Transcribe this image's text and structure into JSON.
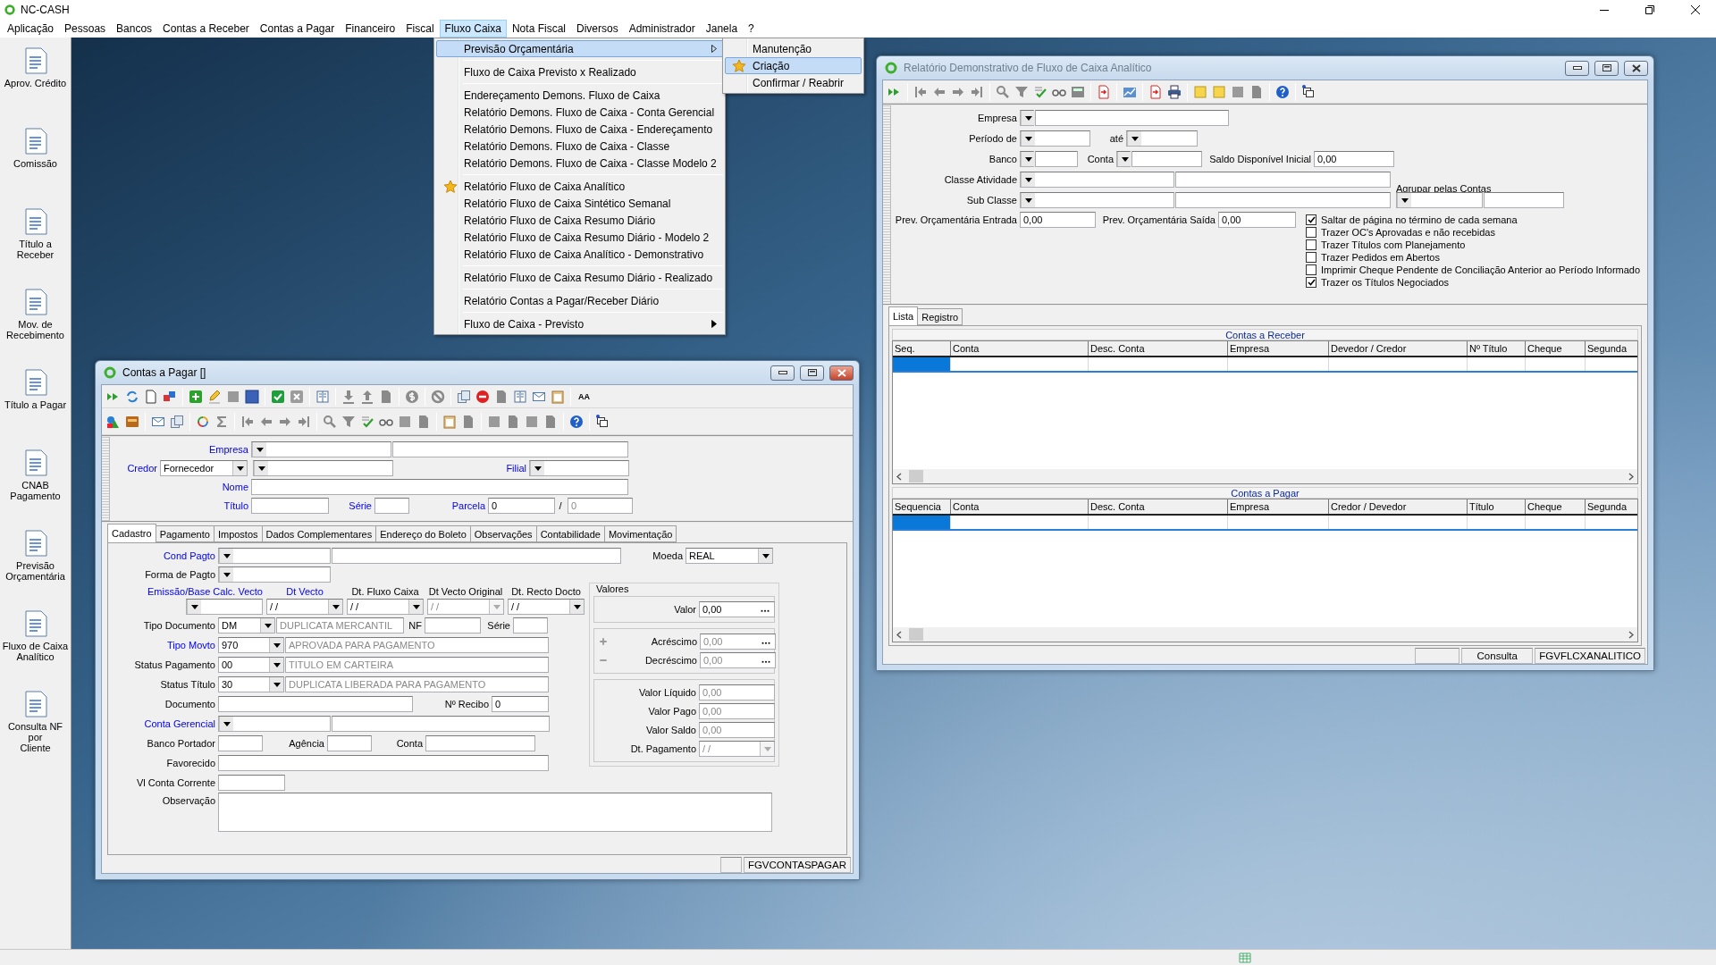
{
  "app": {
    "title": "NC-CASH"
  },
  "menubar": [
    {
      "label": "Aplicação",
      "selected": false
    },
    {
      "label": "Pessoas",
      "selected": false
    },
    {
      "label": "Bancos",
      "selected": false
    },
    {
      "label": "Contas a Receber",
      "selected": false
    },
    {
      "label": "Contas a Pagar",
      "selected": false
    },
    {
      "label": "Financeiro",
      "selected": false
    },
    {
      "label": "Fiscal",
      "selected": false
    },
    {
      "label": "Fluxo Caixa",
      "selected": true
    },
    {
      "label": "Nota Fiscal",
      "selected": false
    },
    {
      "label": "Diversos",
      "selected": false
    },
    {
      "label": "Administrador",
      "selected": false
    },
    {
      "label": "Janela",
      "selected": false
    },
    {
      "label": "?",
      "selected": false
    }
  ],
  "dropdown": {
    "items": [
      {
        "kind": "item",
        "label": "Previsão Orçamentária",
        "selected": true,
        "icon": false,
        "submenu": true
      },
      {
        "kind": "separator"
      },
      {
        "kind": "item",
        "label": "Fluxo de Caixa Previsto x Realizado",
        "selected": false,
        "icon": false,
        "submenu": false
      },
      {
        "kind": "separator"
      },
      {
        "kind": "item",
        "label": "Endereçamento Demons. Fluxo de Caixa",
        "selected": false,
        "icon": false,
        "submenu": false
      },
      {
        "kind": "item",
        "label": "Relatório Demons. Fluxo de Caixa - Conta Gerencial",
        "selected": false,
        "icon": false,
        "submenu": false
      },
      {
        "kind": "item",
        "label": "Relatório Demons. Fluxo de Caixa - Endereçamento",
        "selected": false,
        "icon": false,
        "submenu": false
      },
      {
        "kind": "item",
        "label": "Relatório Demons. Fluxo de Caixa - Classe",
        "selected": false,
        "icon": false,
        "submenu": false
      },
      {
        "kind": "item",
        "label": "Relatório Demons. Fluxo de Caixa - Classe Modelo 2",
        "selected": false,
        "icon": false,
        "submenu": false
      },
      {
        "kind": "separator"
      },
      {
        "kind": "item",
        "label": "Relatório Fluxo de Caixa Analítico",
        "selected": false,
        "icon": true,
        "submenu": false
      },
      {
        "kind": "item",
        "label": "Relatório Fluxo de Caixa Sintético Semanal",
        "selected": false,
        "icon": false,
        "submenu": false
      },
      {
        "kind": "item",
        "label": "Relatório Fluxo de Caixa Resumo Diário",
        "selected": false,
        "icon": false,
        "submenu": false
      },
      {
        "kind": "item",
        "label": "Relatório Fluxo de Caixa Resumo Diário - Modelo 2",
        "selected": false,
        "icon": false,
        "submenu": false
      },
      {
        "kind": "item",
        "label": "Relatório Fluxo de Caixa Analítico - Demonstrativo",
        "selected": false,
        "icon": false,
        "submenu": false
      },
      {
        "kind": "separator"
      },
      {
        "kind": "item",
        "label": "Relatório Fluxo de Caixa Resumo Diário - Realizado",
        "selected": false,
        "icon": false,
        "submenu": false
      },
      {
        "kind": "separator"
      },
      {
        "kind": "item",
        "label": "Relatório Contas a Pagar/Receber Diário",
        "selected": false,
        "icon": false,
        "submenu": false
      },
      {
        "kind": "separator"
      },
      {
        "kind": "item",
        "label": "Fluxo de Caixa - Previsto",
        "selected": false,
        "icon": false,
        "submenu": true
      }
    ]
  },
  "submenu": {
    "items": [
      {
        "label": "Manutenção",
        "selected": false,
        "icon": false
      },
      {
        "label": "Criação",
        "selected": true,
        "icon": true
      },
      {
        "label": "Confirmar / Reabrir",
        "selected": false,
        "icon": false
      }
    ]
  },
  "sidebar": {
    "items": [
      {
        "label": "Aprov. Crédito"
      },
      {
        "label": "Comissão"
      },
      {
        "label": "Título a\nReceber"
      },
      {
        "label": "Mov. de\nRecebimento"
      },
      {
        "label": "Título a Pagar"
      },
      {
        "label": "CNAB\nPagamento"
      },
      {
        "label": "Previsão\nOrçamentária"
      },
      {
        "label": "Fluxo de Caixa\nAnalítico"
      },
      {
        "label": "Consulta NF por\nCliente"
      }
    ]
  },
  "contas_pagar": {
    "title": "Contas a Pagar []",
    "active": true,
    "font_button": "AA",
    "header": {
      "empresa": "Empresa",
      "credor": "Credor",
      "credor_tipo": "Fornecedor",
      "filial": "Filial",
      "nome": "Nome",
      "titulo": "Título",
      "serie": "Série",
      "parcela": "Parcela",
      "parcela_value": "0",
      "parcela_sep": "/",
      "parcela_total": "0"
    },
    "tabs": [
      {
        "label": "Cadastro",
        "selected": true
      },
      {
        "label": "Pagamento",
        "selected": false
      },
      {
        "label": "Impostos",
        "selected": false
      },
      {
        "label": "Dados Complementares",
        "selected": false
      },
      {
        "label": "Endereço do Boleto",
        "selected": false
      },
      {
        "label": "Observações",
        "selected": false
      },
      {
        "label": "Contabilidade",
        "selected": false
      },
      {
        "label": "Movimentação",
        "selected": false
      }
    ],
    "cadastro": {
      "cond_pagto": "Cond Pagto",
      "moeda": "Moeda",
      "moeda_value": "REAL",
      "forma_pagto": "Forma de Pagto",
      "dates": [
        {
          "label": "Emissão/Base Calc. Vecto",
          "link": true,
          "disabled": false
        },
        {
          "label": "Dt Vecto",
          "value": "/ /",
          "link": true,
          "disabled": false
        },
        {
          "label": "Dt. Fluxo Caixa",
          "value": "/ /",
          "link": false,
          "disabled": false
        },
        {
          "label": "Dt Vecto Original",
          "value": "/ /",
          "link": false,
          "disabled": true
        },
        {
          "label": "Dt. Recto Docto",
          "value": "/ /",
          "link": false,
          "disabled": false
        }
      ],
      "tipo_documento": "Tipo Documento",
      "tipo_documento_code": "DM",
      "tipo_documento_desc": "DUPLICATA MERCANTIL",
      "nf": "NF",
      "serie": "Série",
      "status_rows": [
        {
          "label": "Tipo Movto",
          "code": "970",
          "desc": "APROVADA PARA PAGAMENTO",
          "link": true
        },
        {
          "label": "Status Pagamento",
          "code": "00",
          "desc": "TITULO EM CARTEIRA",
          "link": false
        },
        {
          "label": "Status Título",
          "code": "30",
          "desc": "DUPLICATA LIBERADA PARA PAGAMENTO",
          "link": false
        }
      ],
      "documento": "Documento",
      "recibo": "Nº Recibo",
      "recibo_value": "0",
      "conta_gerencial": "Conta Gerencial",
      "banco_portador": "Banco Portador",
      "agencia": "Agência",
      "conta": "Conta",
      "favorecido": "Favorecido",
      "vl_conta_corrente": "Vl Conta Corrente",
      "observacao": "Observação"
    },
    "valores": {
      "title": "Valores",
      "valor": {
        "label": "Valor",
        "value": "0,00"
      },
      "ajustes": [
        {
          "label": "Acréscimo",
          "value": "0,00",
          "kind": "plus"
        },
        {
          "label": "Decréscimo",
          "value": "0,00",
          "kind": "minus"
        }
      ],
      "totais": [
        {
          "label": "Valor Líquido",
          "value": "0,00"
        },
        {
          "label": "Valor Pago",
          "value": "0,00"
        },
        {
          "label": "Valor Saldo",
          "value": "0,00"
        }
      ],
      "dt_pagamento": {
        "label": "Dt. Pagamento",
        "value": "/ /"
      }
    },
    "status": "FGVCONTASPAGAR"
  },
  "relatorio": {
    "title": "Relatório Demonstrativo de Fluxo de Caixa Analítico",
    "active": false,
    "form": {
      "empresa": "Empresa",
      "periodo": "Período de",
      "ate": "até",
      "banco": "Banco",
      "conta": "Conta",
      "saldo": "Saldo Disponível Inicial",
      "saldo_value": "0,00",
      "classe": "Classe Atividade",
      "agrupar": "Agrupar pelas Contas",
      "sub_classe": "Sub Classe",
      "prev_entrada": "Prev. Orçamentária Entrada",
      "prev_entrada_value": "0,00",
      "prev_saida": "Prev. Orçamentária Saída",
      "prev_saida_value": "0,00"
    },
    "options": [
      {
        "label": "Saltar de página no término de cada semana",
        "checked": true
      },
      {
        "label": "Trazer OC's Aprovadas e não recebidas",
        "checked": false
      },
      {
        "label": "Trazer Títulos com Planejamento",
        "checked": false
      },
      {
        "label": "Trazer Pedidos em Abertos",
        "checked": false
      },
      {
        "label": "Imprimir Cheque Pendente de Conciliação Anterior ao Período Informado",
        "checked": false
      },
      {
        "label": "Trazer os Títulos Negociados",
        "checked": true
      }
    ],
    "tabs": [
      {
        "label": "Lista",
        "selected": true
      },
      {
        "label": "Registro",
        "selected": false
      }
    ],
    "grids": [
      {
        "title": "Contas a Receber",
        "columns": [
          "Seq.",
          "Conta",
          "Desc. Conta",
          "Empresa",
          "Devedor / Credor",
          "Nº Título",
          "Cheque",
          "Segunda"
        ]
      },
      {
        "title": "Contas a Pagar",
        "columns": [
          "Sequencia",
          "Conta",
          "Desc. Conta",
          "Empresa",
          "Credor / Devedor",
          "Título",
          "Cheque",
          "Segunda"
        ]
      }
    ],
    "status": [
      "Consulta",
      "FGVFLCXANALITICO"
    ]
  }
}
